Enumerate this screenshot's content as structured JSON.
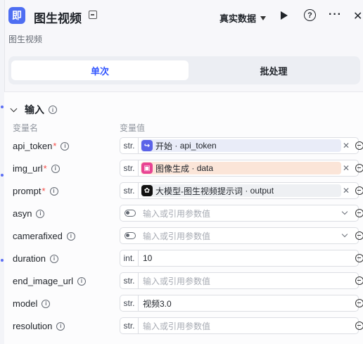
{
  "header": {
    "app_icon_text": "即",
    "title": "图生视频",
    "data_mode": "真实数据",
    "subtitle": "图生视频"
  },
  "tabs": [
    {
      "label": "单次",
      "active": true
    },
    {
      "label": "批处理",
      "active": false
    }
  ],
  "input_section": {
    "title": "输入",
    "col_name": "变量名",
    "col_value": "变量值"
  },
  "params": [
    {
      "name": "api_token",
      "required": true,
      "type": "str.",
      "kind": "ref",
      "source": "开始",
      "value": "api_token",
      "icon_color": "#5b63e8"
    },
    {
      "name": "img_url",
      "required": true,
      "type": "str.",
      "kind": "ref",
      "source": "图像生成",
      "value": "data",
      "icon_color": "#e84393"
    },
    {
      "name": "prompt",
      "required": true,
      "type": "str.",
      "kind": "ref",
      "source": "大模型-图生视频提示词",
      "value": "output",
      "icon_color": "#111111"
    },
    {
      "name": "asyn",
      "required": false,
      "type": "toggle",
      "kind": "select",
      "placeholder": "输入或引用参数值"
    },
    {
      "name": "camerafixed",
      "required": false,
      "type": "toggle",
      "kind": "select",
      "placeholder": "输入或引用参数值"
    },
    {
      "name": "duration",
      "required": false,
      "type": "int.",
      "kind": "value",
      "value": "10"
    },
    {
      "name": "end_image_url",
      "required": false,
      "type": "str.",
      "kind": "empty",
      "placeholder": "输入或引用参数值"
    },
    {
      "name": "model",
      "required": false,
      "type": "str.",
      "kind": "value",
      "value": "视频3.0"
    },
    {
      "name": "resolution",
      "required": false,
      "type": "str.",
      "kind": "empty",
      "placeholder": "输入或引用参数值"
    }
  ]
}
